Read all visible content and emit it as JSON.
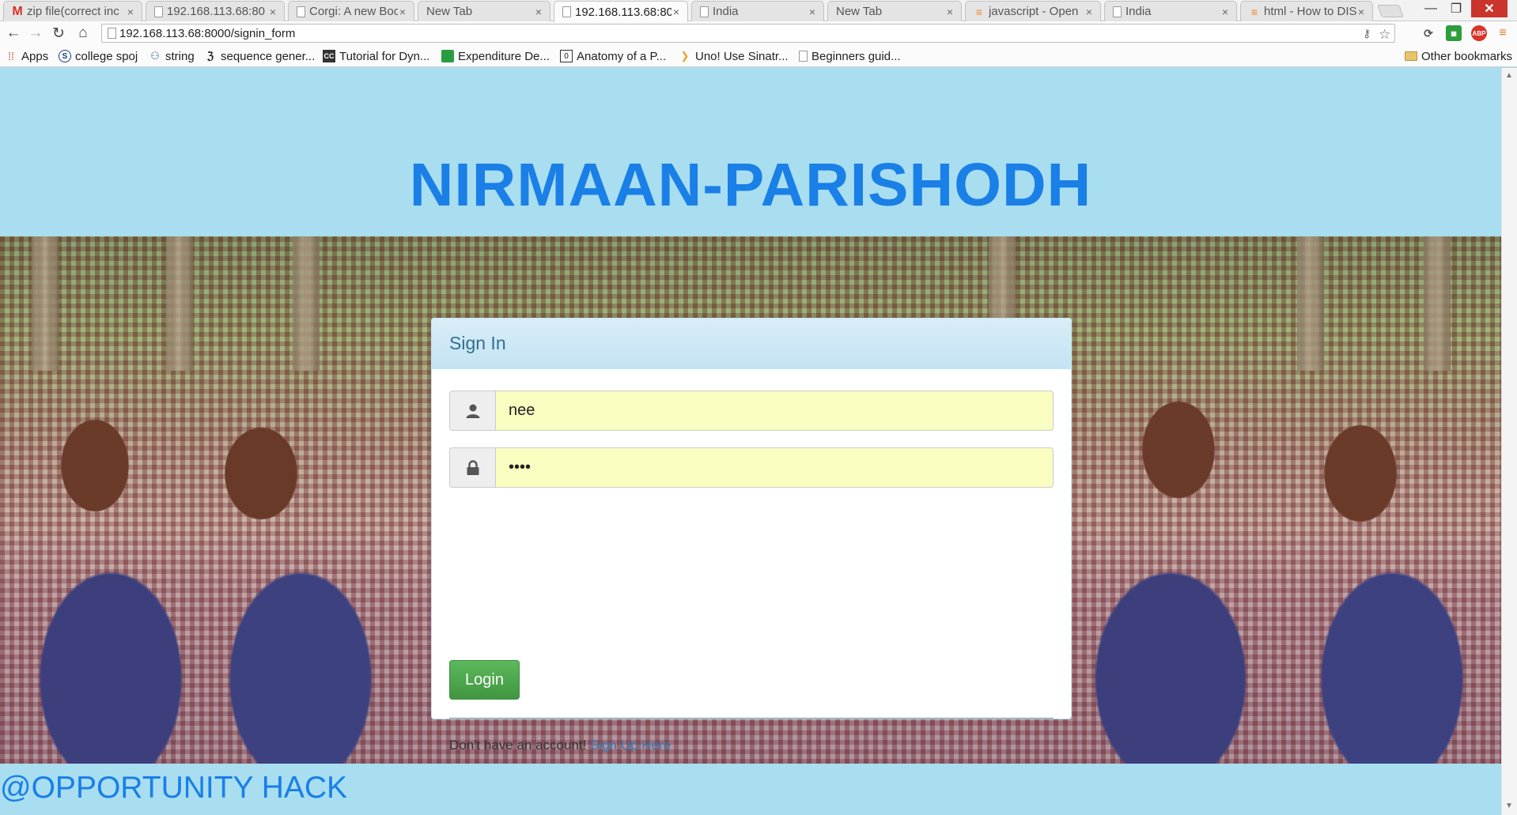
{
  "browser": {
    "tabs": [
      {
        "title": "zip file(correct inc",
        "icon": "gmail-icon"
      },
      {
        "title": "192.168.113.68:80",
        "icon": "page-icon"
      },
      {
        "title": "Corgi: A new Boo",
        "icon": "page-icon"
      },
      {
        "title": "New Tab",
        "icon": "none"
      },
      {
        "title": "192.168.113.68:80",
        "icon": "page-icon",
        "active": true
      },
      {
        "title": "India",
        "icon": "page-icon"
      },
      {
        "title": "New Tab",
        "icon": "none"
      },
      {
        "title": "javascript - Open",
        "icon": "stackoverflow-icon"
      },
      {
        "title": "India",
        "icon": "page-icon"
      },
      {
        "title": "html - How to DIS",
        "icon": "stackoverflow-icon"
      }
    ],
    "url": "192.168.113.68:8000/signin_form",
    "bookmarks": [
      {
        "label": "Apps",
        "icon": "apps-grid-icon"
      },
      {
        "label": "college spoj",
        "icon": "spoj-icon"
      },
      {
        "label": "string",
        "icon": "bookmark-icon"
      },
      {
        "label": "sequence gener...",
        "icon": "bookmark-icon"
      },
      {
        "label": "Tutorial for Dyn...",
        "icon": "bookmark-icon"
      },
      {
        "label": "Expenditure De...",
        "icon": "sheets-icon"
      },
      {
        "label": "Anatomy of a P...",
        "icon": "bookmark-icon"
      },
      {
        "label": "Uno! Use Sinatr...",
        "icon": "bookmark-icon"
      },
      {
        "label": "Beginners guid...",
        "icon": "page-icon"
      }
    ],
    "other_bookmarks": "Other bookmarks",
    "extension_labels": {
      "ext1": "ABP"
    },
    "colors": {
      "close": "#c9352c"
    }
  },
  "page": {
    "title": "NIRMAAN-PARISHODH",
    "title_color": "#1a7fe6",
    "background_color": "#a8def0",
    "footer": "@OPPORTUNITY HACK"
  },
  "signin": {
    "heading": "Sign In",
    "username_value": "nee",
    "password_value": "nee1",
    "login_label": "Login",
    "no_account_text": "Don't have an account!",
    "signup_link": "Sign Up Here",
    "colors": {
      "button": "#5cb85c",
      "link": "#337ab7",
      "heading": "#31708f",
      "field_autofill": "#fafdc0"
    }
  }
}
